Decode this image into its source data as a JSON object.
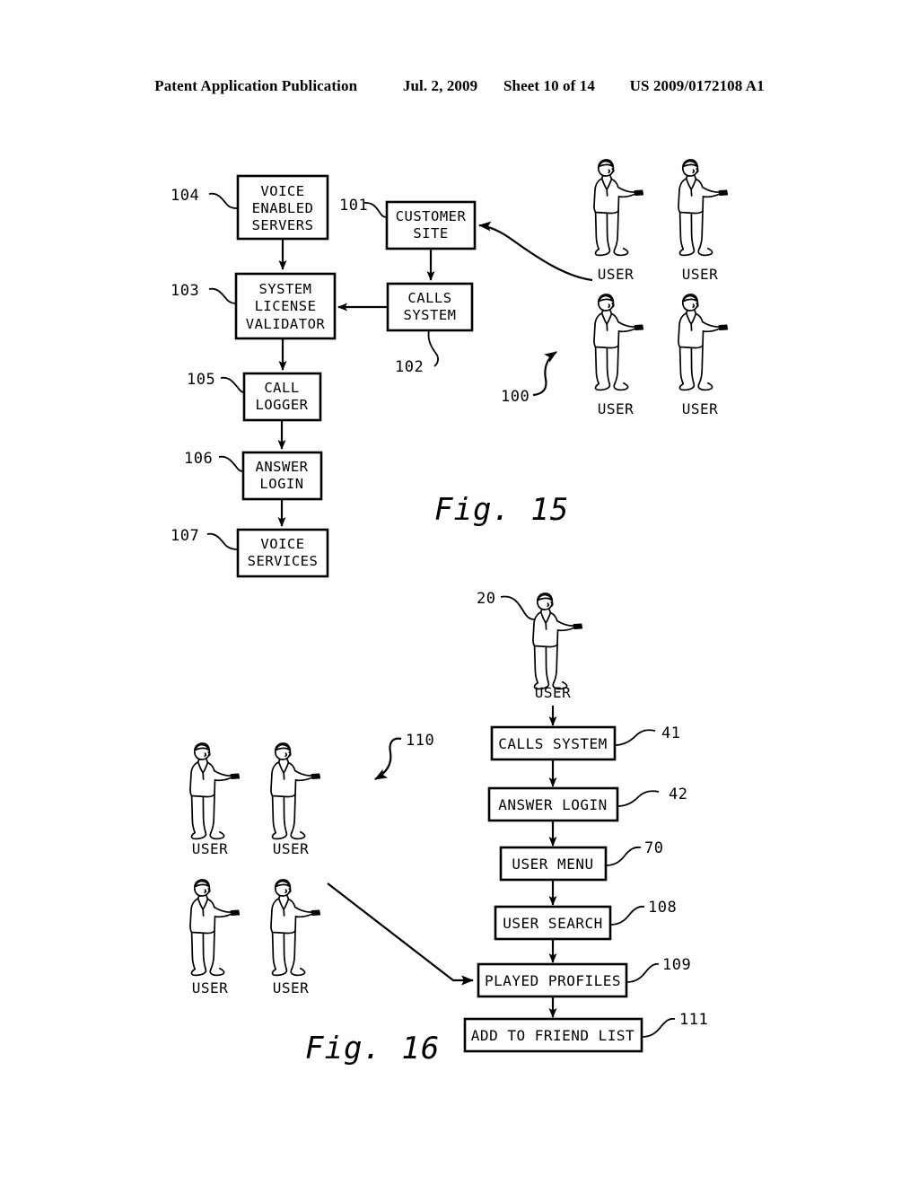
{
  "header": {
    "publication": "Patent Application Publication",
    "date": "Jul. 2, 2009",
    "sheet": "Sheet 10 of 14",
    "patent_number": "US 2009/0172108 A1"
  },
  "figures": [
    {
      "caption": "Fig. 15",
      "system_ref": "100",
      "boxes": [
        {
          "ref": "104",
          "label_lines": [
            "VOICE",
            "ENABLED",
            "SERVERS"
          ]
        },
        {
          "ref": "103",
          "label_lines": [
            "SYSTEM",
            "LICENSE",
            "VALIDATOR"
          ]
        },
        {
          "ref": "105",
          "label_lines": [
            "CALL",
            "LOGGER"
          ]
        },
        {
          "ref": "106",
          "label_lines": [
            "ANSWER",
            "LOGIN"
          ]
        },
        {
          "ref": "107",
          "label_lines": [
            "VOICE",
            "SERVICES"
          ]
        },
        {
          "ref": "101",
          "label_lines": [
            "CUSTOMER",
            "SITE"
          ]
        },
        {
          "ref": "102",
          "label_lines": [
            "CALLS",
            "SYSTEM"
          ]
        }
      ],
      "users": [
        {
          "label": "USER"
        },
        {
          "label": "USER"
        },
        {
          "label": "USER"
        },
        {
          "label": "USER"
        }
      ]
    },
    {
      "caption": "Fig. 16",
      "user_group_ref": "110",
      "actor": {
        "ref": "20",
        "label": "USER"
      },
      "boxes": [
        {
          "ref": "41",
          "label": "CALLS SYSTEM"
        },
        {
          "ref": "42",
          "label": "ANSWER LOGIN"
        },
        {
          "ref": "70",
          "label": "USER MENU"
        },
        {
          "ref": "108",
          "label": "USER SEARCH"
        },
        {
          "ref": "109",
          "label": "PLAYED PROFILES"
        },
        {
          "ref": "111",
          "label": "ADD TO FRIEND LIST"
        }
      ],
      "users": [
        {
          "label": "USER"
        },
        {
          "label": "USER"
        },
        {
          "label": "USER"
        },
        {
          "label": "USER"
        }
      ]
    }
  ],
  "colors": {
    "ink": "#000000",
    "paper": "#ffffff"
  }
}
